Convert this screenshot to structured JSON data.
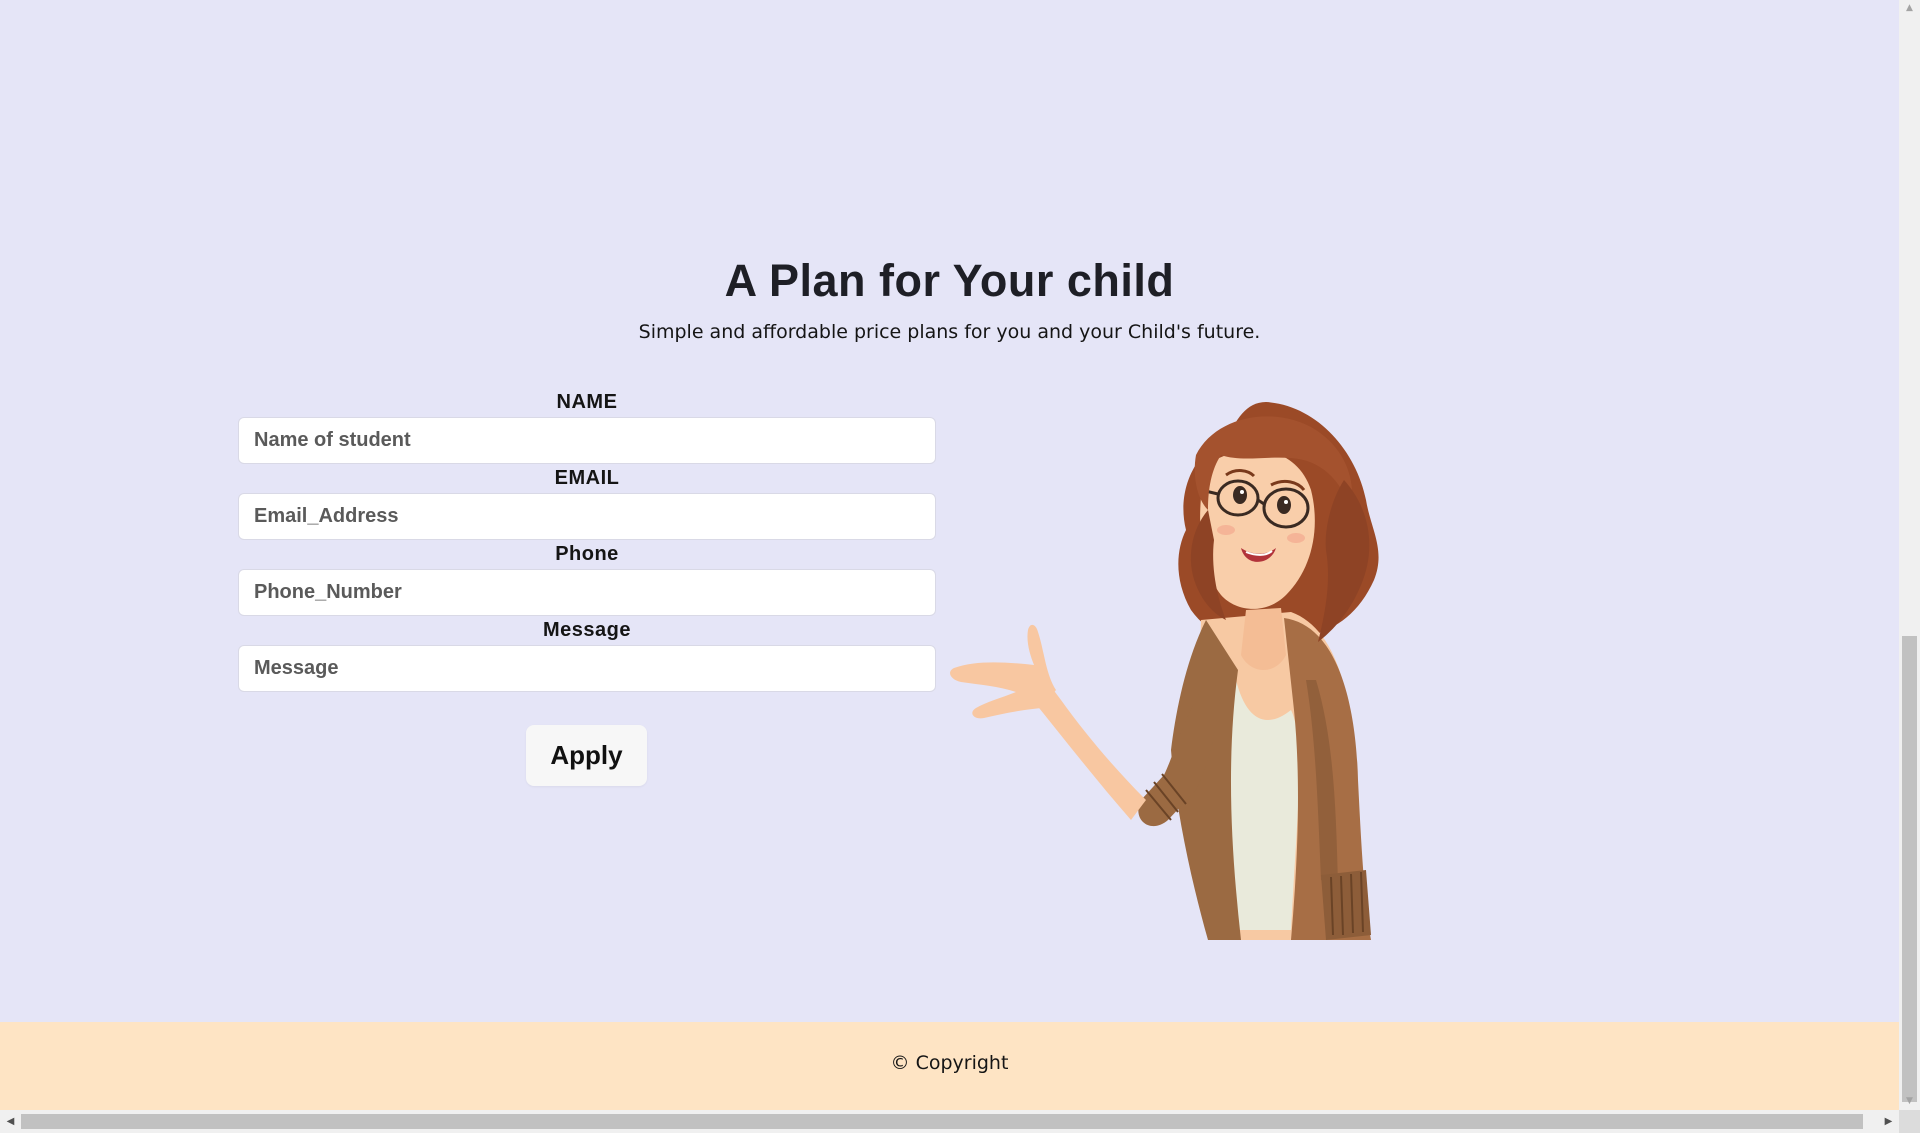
{
  "top_cut_text": "· · ·",
  "section": {
    "title": "A Plan for Your child",
    "subtitle": "Simple and affordable price plans for you and your Child's future."
  },
  "form": {
    "name_label": "NAME",
    "name_placeholder": "Name of student",
    "email_label": "EMAIL",
    "email_placeholder": "Email_Address",
    "phone_label": "Phone",
    "phone_placeholder": "Phone_Number",
    "message_label": "Message",
    "message_placeholder": "Message",
    "submit_label": "Apply"
  },
  "illustration": {
    "icon": "teacher-woman-illustration"
  },
  "footer": {
    "copyright": "© Copyright"
  },
  "colors": {
    "background": "#e5e5f7",
    "footer_bg": "#fee4c4",
    "button_bg": "#f7f7f7",
    "hair": "#a4522e",
    "jacket": "#9b6a42"
  },
  "scrollbars": {
    "vertical_up_icon": "arrow-up-icon",
    "vertical_down_icon": "arrow-down-icon",
    "horizontal_left_icon": "arrow-left-icon",
    "horizontal_right_icon": "arrow-right-icon"
  }
}
